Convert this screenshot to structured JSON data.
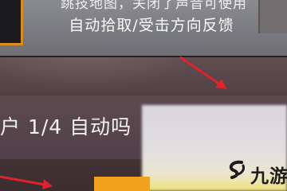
{
  "hint": {
    "line_top": "跳技地图，关闭了声音可使用",
    "line_main": "自动拾取/受击方向反馈"
  },
  "setting_row": {
    "label": "户 1/4 自动吗"
  },
  "watermark": {
    "text": "九游",
    "icon": "swirl-logo-icon",
    "color": "#1c1c1c"
  },
  "annotation": {
    "arrow_color": "#e0232b"
  }
}
